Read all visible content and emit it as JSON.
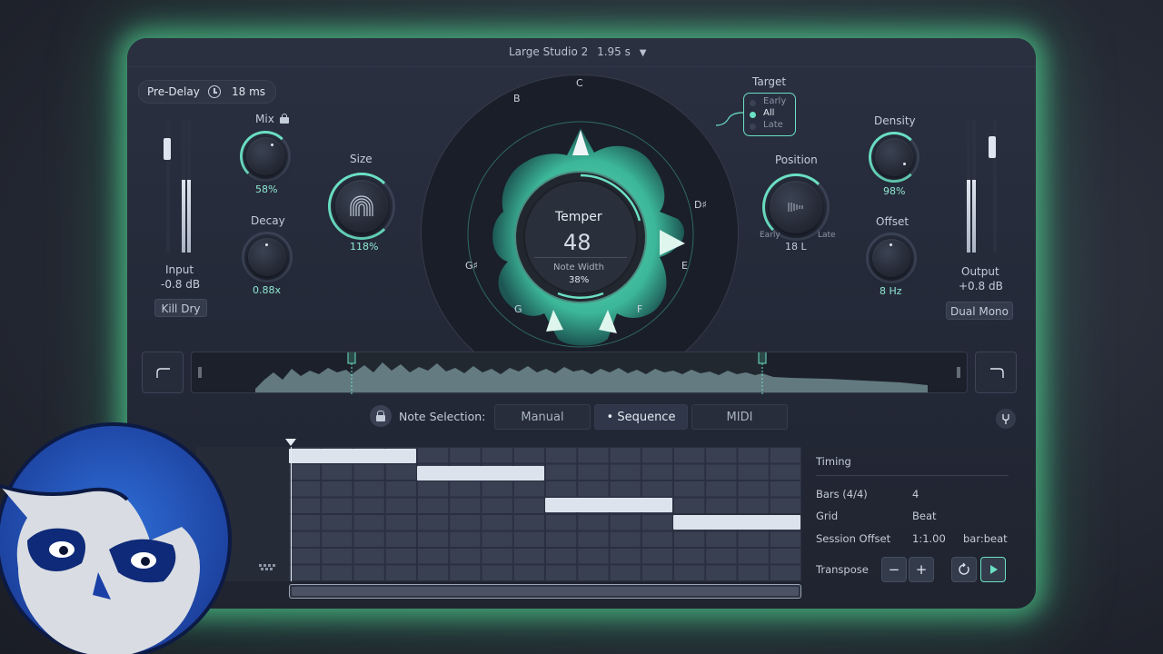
{
  "header": {
    "preset_name": "Large Studio 2",
    "preset_time": "1.95 s",
    "dropdown_icon": "chevron-down-icon"
  },
  "predelay": {
    "label": "Pre-Delay",
    "icon": "clock-icon",
    "value": "18 ms"
  },
  "input": {
    "label": "Input",
    "value": "-0.8 dB",
    "kill_dry": "Kill Dry"
  },
  "mix": {
    "label": "Mix",
    "value": "58%",
    "lock_icon": "lock-icon"
  },
  "decay": {
    "label": "Decay",
    "value": "0.88x"
  },
  "size": {
    "label": "Size",
    "value": "118%"
  },
  "temper": {
    "title": "Temper",
    "value": "48",
    "sub_label": "Note Width",
    "sub_value": "38%",
    "notes": [
      "C",
      "B",
      "D♯",
      "E",
      "F",
      "G",
      "G♯"
    ]
  },
  "target": {
    "label": "Target",
    "options": [
      "Early",
      "All",
      "Late"
    ],
    "selected": "All"
  },
  "position": {
    "label": "Position",
    "value": "18 L",
    "left": "Early",
    "right": "Late"
  },
  "density": {
    "label": "Density",
    "value": "98%"
  },
  "offset": {
    "label": "Offset",
    "value": "8 Hz"
  },
  "output": {
    "label": "Output",
    "value": "+0.8 dB",
    "dual_mono": "Dual Mono"
  },
  "note_selection": {
    "label": "Note Selection:",
    "tabs": [
      "Manual",
      "• Sequence",
      "MIDI"
    ],
    "active": "• Sequence"
  },
  "timing": {
    "title": "Timing",
    "rows": [
      {
        "label": "Bars (4/4)",
        "value": "4"
      },
      {
        "label": "Grid",
        "value": "Beat"
      },
      {
        "label": "Session Offset",
        "value": "1:1.00",
        "unit": "bar:beat"
      }
    ],
    "transpose_label": "Transpose",
    "minus": "−",
    "plus": "+",
    "loop_icon": "loop-icon",
    "play_icon": "play-icon"
  },
  "colors": {
    "accent": "#6be0c4",
    "glow": "#58eca0",
    "panel": "#232837"
  }
}
